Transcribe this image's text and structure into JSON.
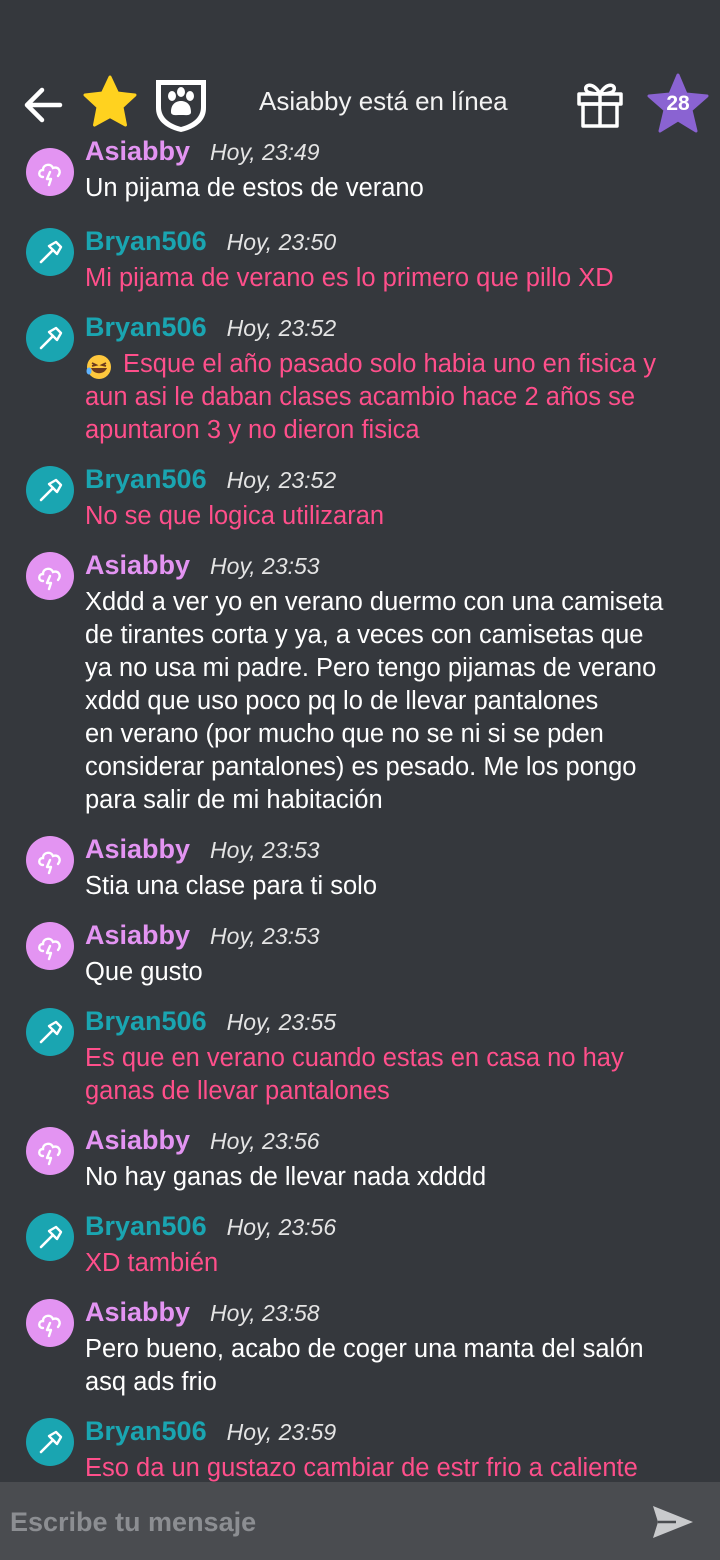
{
  "header": {
    "title": "Asiabby está en línea",
    "level": "28"
  },
  "messages": [
    {
      "user": "Asiabby",
      "time": "Hoy, 23:49",
      "text": "Un pijama de estos de verano"
    },
    {
      "user": "Bryan506",
      "time": "Hoy, 23:50",
      "text": "Mi pijama de verano es lo primero que pillo XD"
    },
    {
      "user": "Bryan506",
      "time": "Hoy, 23:52",
      "text": "Esque el año pasado solo habia uno en fisica y\naun asi le daban clases acambio hace 2 años se\napuntaron 3 y no dieron fisica",
      "emoji": "rofl-emoji"
    },
    {
      "user": "Bryan506",
      "time": "Hoy, 23:52",
      "text": "No se que logica utilizaran"
    },
    {
      "user": "Asiabby",
      "time": "Hoy, 23:53",
      "text": "Xddd a ver yo en verano duermo con una camiseta\nde tirantes corta y ya, a veces con camisetas que\nya no usa mi padre. Pero tengo pijamas de verano\nxddd que uso poco pq lo de llevar pantalones\nen verano (por mucho que no se ni si se pden\nconsiderar pantalones) es pesado. Me los pongo\npara salir de mi habitación"
    },
    {
      "user": "Asiabby",
      "time": "Hoy, 23:53",
      "text": "Stia una clase para ti solo"
    },
    {
      "user": "Asiabby",
      "time": "Hoy, 23:53",
      "text": "Que gusto"
    },
    {
      "user": "Bryan506",
      "time": "Hoy, 23:55",
      "text": "Es que en verano cuando estas en casa no hay\nganas de llevar pantalones"
    },
    {
      "user": "Asiabby",
      "time": "Hoy, 23:56",
      "text": "No hay ganas de llevar nada xdddd"
    },
    {
      "user": "Bryan506",
      "time": "Hoy, 23:56",
      "text": "XD también"
    },
    {
      "user": "Asiabby",
      "time": "Hoy, 23:58",
      "text": "Pero bueno, acabo de coger una manta del salón\nasq ads frio"
    },
    {
      "user": "Bryan506",
      "time": "Hoy, 23:59",
      "text": "Eso da un gustazo cambiar de estr frio a caliente"
    }
  ],
  "composer": {
    "placeholder": "Escribe tu mensaje"
  },
  "colors": {
    "background": "#35383d",
    "asiabby": "#e394f2",
    "bryan": "#1aa5b1",
    "bryan_text": "#ff4f8b",
    "level_star": "#8a63d2",
    "gold_star": "#ffd21f"
  }
}
